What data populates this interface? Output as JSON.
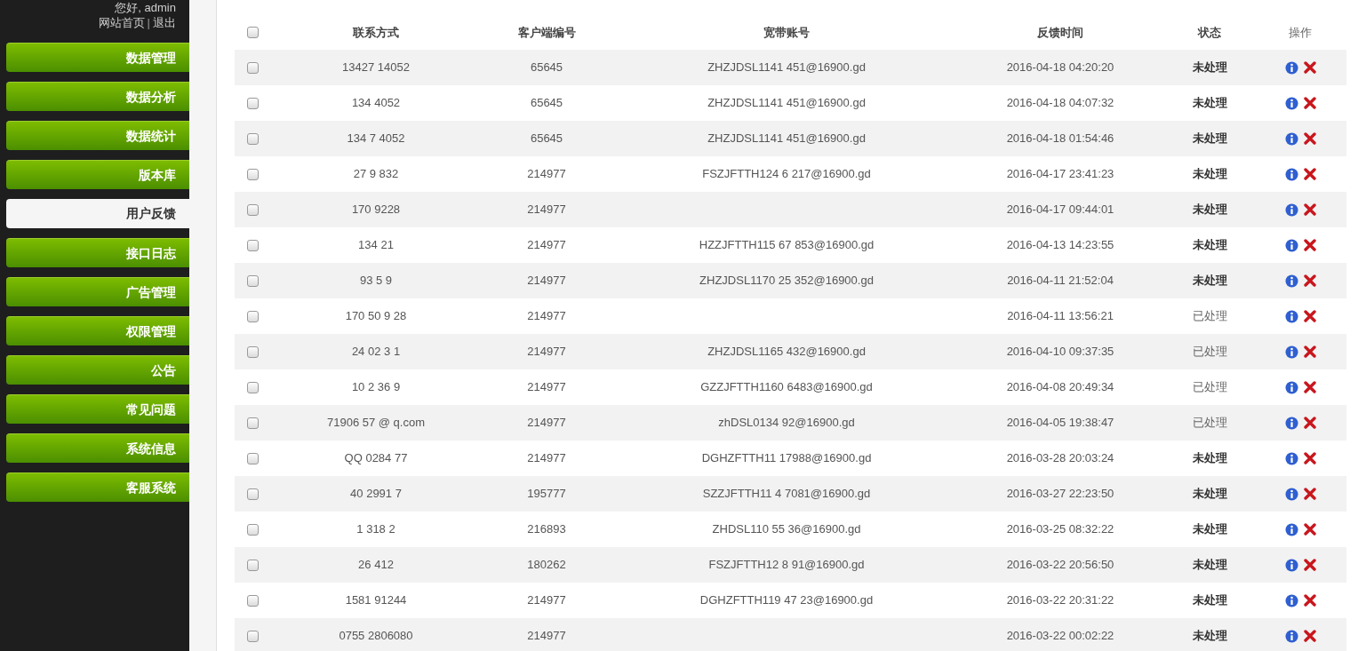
{
  "sidebar": {
    "greeting": "您好, admin",
    "links": [
      "网站首页",
      "退出"
    ],
    "separator": "|",
    "items": [
      {
        "label": "数据管理",
        "selected": false
      },
      {
        "label": "数据分析",
        "selected": false
      },
      {
        "label": "数据统计",
        "selected": false
      },
      {
        "label": "版本库",
        "selected": false
      },
      {
        "label": "用户反馈",
        "selected": true
      },
      {
        "label": "接口日志",
        "selected": false
      },
      {
        "label": "广告管理",
        "selected": false
      },
      {
        "label": "权限管理",
        "selected": false
      },
      {
        "label": "公告",
        "selected": false
      },
      {
        "label": "常见问题",
        "selected": false
      },
      {
        "label": "系统信息",
        "selected": false
      },
      {
        "label": "客服系统",
        "selected": false
      }
    ]
  },
  "table": {
    "columns": [
      "联系方式",
      "客户端编号",
      "宽带账号",
      "反馈时间",
      "状态",
      "操作"
    ],
    "select_all_checked": false,
    "rows": [
      {
        "contact": "13427 14052",
        "client": "65645",
        "account": "ZHZJDSL1141 451@16900.gd",
        "time": "2016-04-18 04:20:20",
        "status": "未处理",
        "processed": false,
        "checked": false
      },
      {
        "contact": "134 4052",
        "client": "65645",
        "account": "ZHZJDSL1141 451@16900.gd",
        "time": "2016-04-18 04:07:32",
        "status": "未处理",
        "processed": false,
        "checked": false
      },
      {
        "contact": "134 7 4052",
        "client": "65645",
        "account": "ZHZJDSL1141 451@16900.gd",
        "time": "2016-04-18 01:54:46",
        "status": "未处理",
        "processed": false,
        "checked": false
      },
      {
        "contact": "27 9 832",
        "client": "214977",
        "account": "FSZJFTTH124 6 217@16900.gd",
        "time": "2016-04-17 23:41:23",
        "status": "未处理",
        "processed": false,
        "checked": false
      },
      {
        "contact": "170 9228",
        "client": "214977",
        "time": "2016-04-17 09:44:01",
        "status": "未处理",
        "processed": false,
        "checked": false
      },
      {
        "contact": "134 21",
        "client": "214977",
        "account": "HZZJFTTH115 67 853@16900.gd",
        "time": "2016-04-13 14:23:55",
        "status": "未处理",
        "processed": false,
        "checked": false
      },
      {
        "contact": "93 5 9",
        "client": "214977",
        "account": "ZHZJDSL1170 25 352@16900.gd",
        "time": "2016-04-11 21:52:04",
        "status": "未处理",
        "processed": false,
        "checked": false
      },
      {
        "contact": "170 50 9 28",
        "client": "214977",
        "time": "2016-04-11 13:56:21",
        "status": "已处理",
        "processed": true,
        "checked": false
      },
      {
        "contact": "24 02 3 1",
        "client": "214977",
        "account": "ZHZJDSL1165 432@16900.gd",
        "time": "2016-04-10 09:37:35",
        "status": "已处理",
        "processed": true,
        "checked": false
      },
      {
        "contact": "10 2 36 9",
        "client": "214977",
        "account": "GZZJFTTH1160 6483@16900.gd",
        "time": "2016-04-08 20:49:34",
        "status": "已处理",
        "processed": true,
        "checked": false
      },
      {
        "contact": "71906 57 @ q.com",
        "client": "214977",
        "account": "zhDSL0134 92@16900.gd",
        "time": "2016-04-05 19:38:47",
        "status": "已处理",
        "processed": true,
        "checked": false
      },
      {
        "contact": "QQ 0284 77",
        "client": "214977",
        "account": "DGHZFTTH11 17988@16900.gd",
        "time": "2016-03-28 20:03:24",
        "status": "未处理",
        "processed": false,
        "checked": false
      },
      {
        "contact": "40 2991 7",
        "client": "195777",
        "account": "SZZJFTTH11 4 7081@16900.gd",
        "time": "2016-03-27 22:23:50",
        "status": "未处理",
        "processed": false,
        "checked": false
      },
      {
        "contact": "1 318 2",
        "client": "216893",
        "account": "ZHDSL110 55 36@16900.gd",
        "time": "2016-03-25 08:32:22",
        "status": "未处理",
        "processed": false,
        "checked": false
      },
      {
        "contact": "26 412",
        "client": "180262",
        "account": "FSZJFTTH12 8 91@16900.gd",
        "time": "2016-03-22 20:56:50",
        "status": "未处理",
        "processed": false,
        "checked": false
      },
      {
        "contact": "1581 91244",
        "client": "214977",
        "account": "DGHZFTTH119 47 23@16900.gd",
        "time": "2016-03-22 20:31:22",
        "status": "未处理",
        "processed": false,
        "checked": false
      },
      {
        "contact": "0755 2806080",
        "client": "214977",
        "time": "2016-03-22 00:02:22",
        "status": "未处理",
        "processed": false,
        "checked": false
      }
    ]
  }
}
